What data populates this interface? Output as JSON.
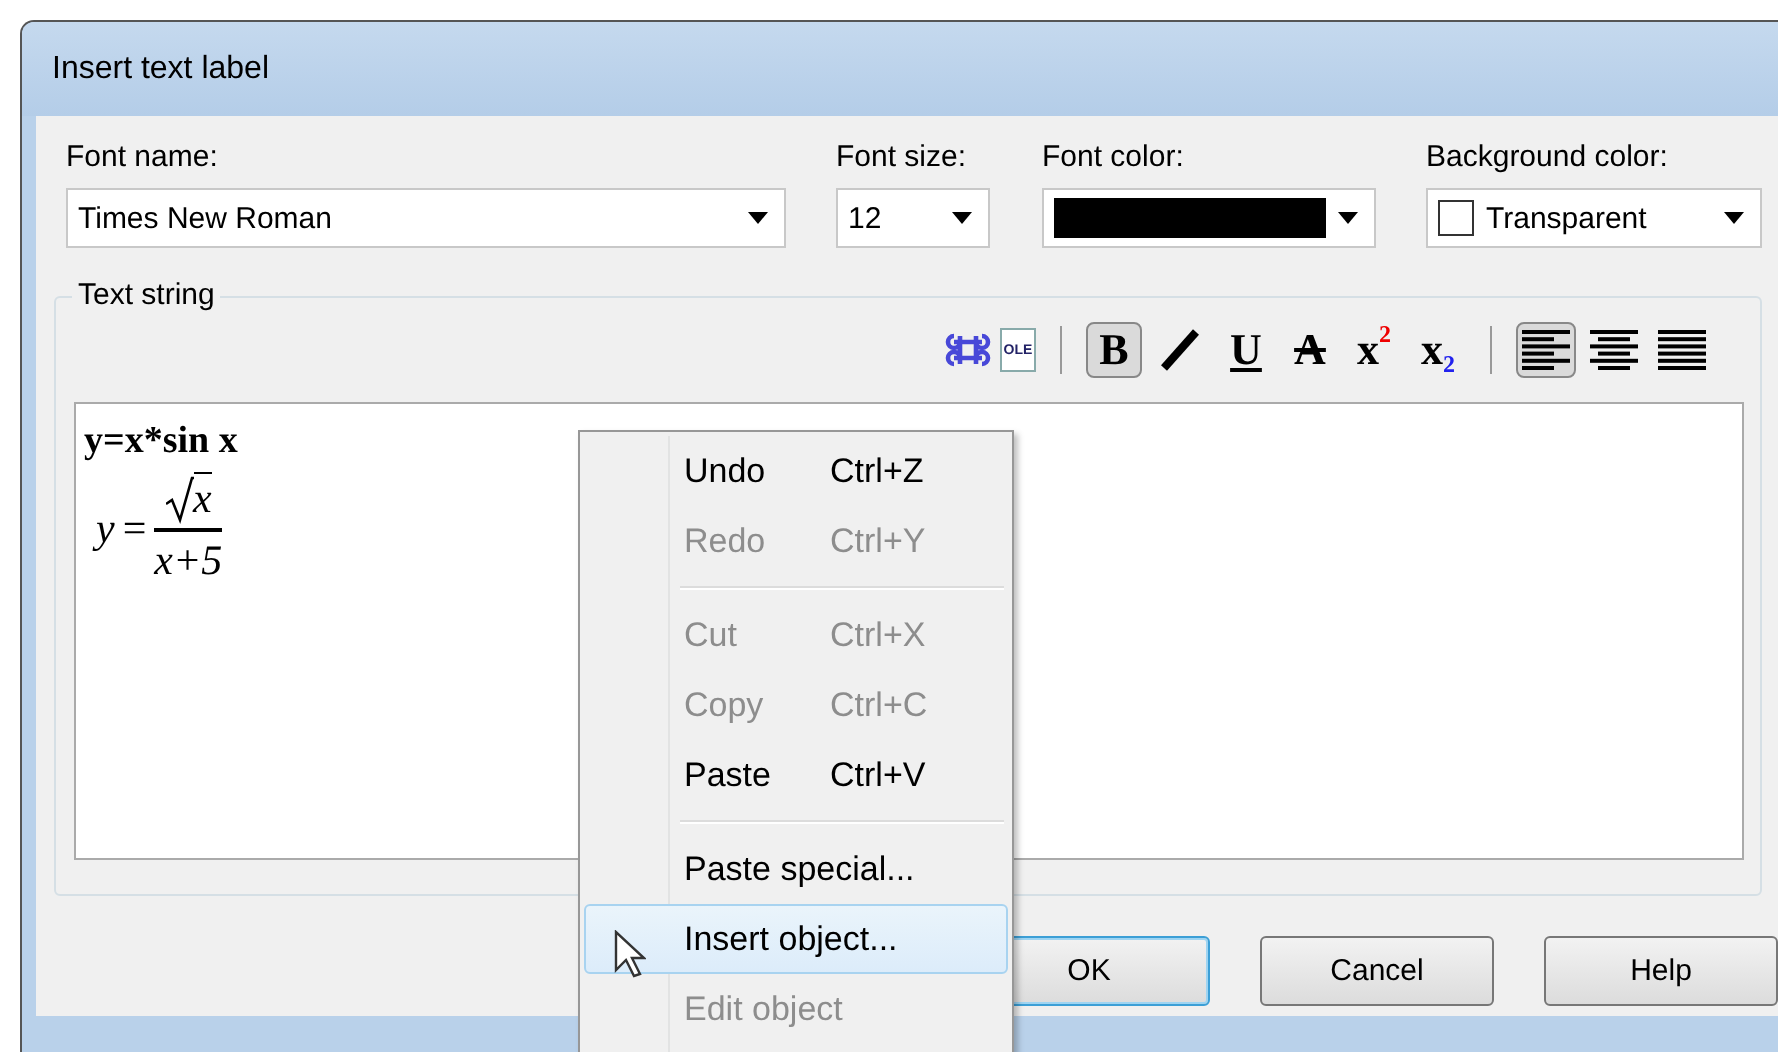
{
  "window": {
    "title": "Insert text label"
  },
  "fields": [
    {
      "kind": "font",
      "label": "Font name:",
      "value": "Times New Roman"
    },
    {
      "kind": "size",
      "label": "Font size:",
      "value": "12"
    },
    {
      "kind": "color",
      "label": "Font color:",
      "color": "#000000"
    },
    {
      "kind": "background",
      "label": "Background color:",
      "value": "Transparent"
    }
  ],
  "text_string": {
    "title": "Text string",
    "toolbar": [
      {
        "kind": "symbol"
      },
      {
        "kind": "ole",
        "label": "OLE"
      },
      {
        "kind": "separator"
      },
      {
        "kind": "bold",
        "label": "B",
        "selected": true
      },
      {
        "kind": "italic",
        "selected": false
      },
      {
        "kind": "underline",
        "label": "U",
        "selected": false
      },
      {
        "kind": "strike",
        "label": "A",
        "selected": false
      },
      {
        "kind": "superscript",
        "label": "x",
        "mark": "2",
        "selected": false
      },
      {
        "kind": "subscript",
        "label": "x",
        "mark": "2",
        "selected": false
      },
      {
        "kind": "separator"
      },
      {
        "kind": "align-left",
        "selected": true
      },
      {
        "kind": "align-center",
        "selected": false
      },
      {
        "kind": "align-right",
        "selected": false
      }
    ],
    "content": [
      {
        "kind": "text",
        "text": "y=x*sin x"
      },
      {
        "kind": "formula",
        "lhs": "y",
        "equals": "=",
        "numerator": "x",
        "denominator": "x+5"
      }
    ]
  },
  "buttons": [
    {
      "label": "OK",
      "default": true
    },
    {
      "label": "Cancel",
      "default": false
    },
    {
      "label": "Help",
      "default": false
    }
  ],
  "context_menu": [
    {
      "kind": "item",
      "label": "Undo",
      "shortcut": "Ctrl+Z",
      "disabled": false,
      "selected": false
    },
    {
      "kind": "item",
      "label": "Redo",
      "shortcut": "Ctrl+Y",
      "disabled": true,
      "selected": false
    },
    {
      "kind": "separator"
    },
    {
      "kind": "item",
      "label": "Cut",
      "shortcut": "Ctrl+X",
      "disabled": true,
      "selected": false
    },
    {
      "kind": "item",
      "label": "Copy",
      "shortcut": "Ctrl+C",
      "disabled": true,
      "selected": false
    },
    {
      "kind": "item",
      "label": "Paste",
      "shortcut": "Ctrl+V",
      "disabled": false,
      "selected": false
    },
    {
      "kind": "separator"
    },
    {
      "kind": "item",
      "label": "Paste special...",
      "disabled": false,
      "selected": false
    },
    {
      "kind": "item",
      "label": "Insert object...",
      "disabled": false,
      "selected": true
    },
    {
      "kind": "item",
      "label": "Edit object",
      "disabled": true,
      "selected": false
    }
  ]
}
